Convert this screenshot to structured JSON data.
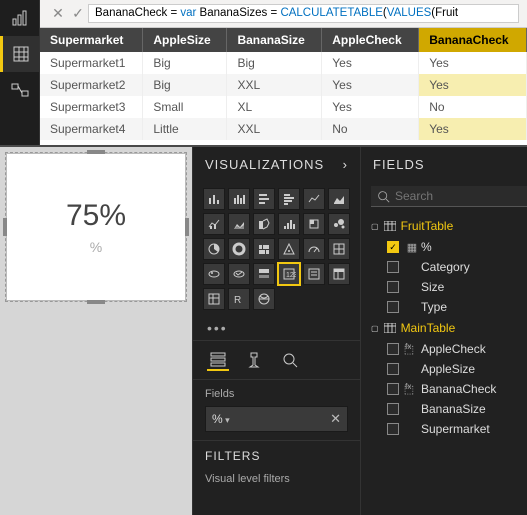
{
  "formula": {
    "text": "BananaCheck = var BananaSizes = CALCULATETABLE(VALUES(Fruit",
    "parts": [
      {
        "t": "BananaCheck",
        "c": "kw-black"
      },
      {
        "t": " = ",
        "c": "kw-black"
      },
      {
        "t": "var",
        "c": "kw-blue"
      },
      {
        "t": " BananaSizes ",
        "c": "kw-black"
      },
      {
        "t": "= ",
        "c": "kw-black"
      },
      {
        "t": "CALCULATETABLE",
        "c": "kw-blue"
      },
      {
        "t": "(",
        "c": "kw-black"
      },
      {
        "t": "VALUES",
        "c": "kw-blue"
      },
      {
        "t": "(Fruit",
        "c": "kw-black"
      }
    ]
  },
  "grid": {
    "columns": [
      "Supermarket",
      "AppleSize",
      "BananaSize",
      "AppleCheck",
      "BananaCheck"
    ],
    "selected_col": 4,
    "rows": [
      [
        "Supermarket1",
        "Big",
        "Big",
        "Yes",
        "Yes"
      ],
      [
        "Supermarket2",
        "Big",
        "XXL",
        "Yes",
        "Yes"
      ],
      [
        "Supermarket3",
        "Small",
        "XL",
        "Yes",
        "No"
      ],
      [
        "Supermarket4",
        "Little",
        "XXL",
        "No",
        "Yes"
      ]
    ]
  },
  "card": {
    "value": "75%",
    "label": "%"
  },
  "viz_pane": {
    "title": "VISUALIZATIONS",
    "fields_label": "Fields",
    "well_field": "%",
    "filters_title": "FILTERS",
    "filters_sub": "Visual level filters"
  },
  "fields_pane": {
    "title": "FIELDS",
    "search_placeholder": "Search",
    "tables": [
      {
        "name": "FruitTable",
        "fields": [
          {
            "name": "%",
            "checked": true,
            "icon": "measure"
          },
          {
            "name": "Category",
            "checked": false,
            "icon": ""
          },
          {
            "name": "Size",
            "checked": false,
            "icon": ""
          },
          {
            "name": "Type",
            "checked": false,
            "icon": ""
          }
        ]
      },
      {
        "name": "MainTable",
        "fields": [
          {
            "name": "AppleCheck",
            "checked": false,
            "icon": "fx"
          },
          {
            "name": "AppleSize",
            "checked": false,
            "icon": ""
          },
          {
            "name": "BananaCheck",
            "checked": false,
            "icon": "fx"
          },
          {
            "name": "BananaSize",
            "checked": false,
            "icon": ""
          },
          {
            "name": "Supermarket",
            "checked": false,
            "icon": ""
          }
        ]
      }
    ]
  }
}
